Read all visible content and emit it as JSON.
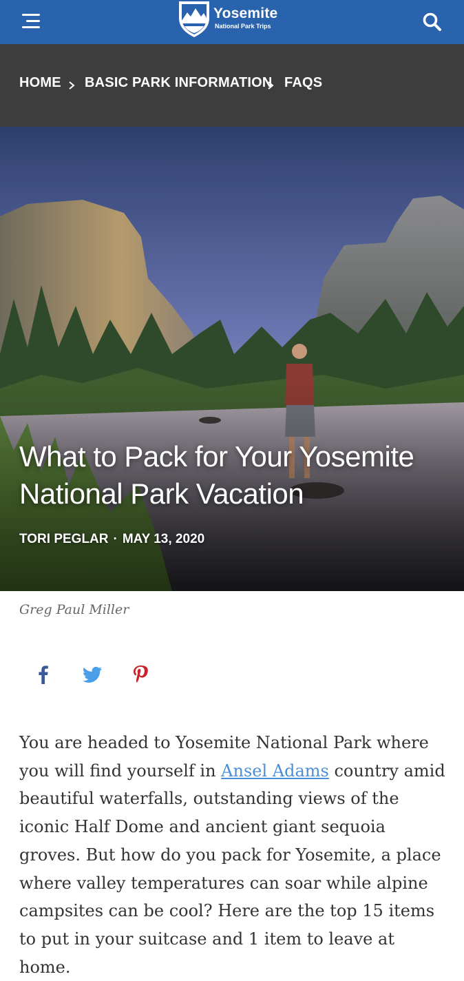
{
  "header": {
    "logo_title": "Yosemite",
    "logo_subtitle": "National Park Trips",
    "brand_color": "#2a63ad",
    "menu_icon": "menu-icon",
    "search_icon": "search-icon"
  },
  "breadcrumb": {
    "items": [
      "HOME",
      "BASIC PARK INFORMATION",
      "FAQS"
    ],
    "separator_icon": "chevron-right-icon",
    "bg_color": "#3d3d3d"
  },
  "hero": {
    "title": "What to Pack for Your Yosemite National Park Vacation",
    "author": "TORI PEGLAR",
    "separator": "·",
    "date": "MAY 13, 2020",
    "photo_credit": "Greg Paul Miller"
  },
  "share": {
    "icons": [
      "facebook-icon",
      "twitter-icon",
      "pinterest-icon"
    ],
    "colors": {
      "facebook": "#3b5998",
      "twitter": "#4a9fe8",
      "pinterest": "#c92228"
    }
  },
  "article": {
    "intro_before_link": "You are headed to Yosemite National Park where you will find yourself in ",
    "link_text": "Ansel Adams",
    "intro_after_link": " country amid beautiful waterfalls, outstanding views of the iconic Half Dome and ancient giant sequoia groves. But how do you pack for Yosemite, a place where valley temperatures can soar while alpine campsites can be cool? Here are the top 15 items to put in your suitcase and 1 item to leave at home.",
    "link_color": "#4a8fd6"
  }
}
